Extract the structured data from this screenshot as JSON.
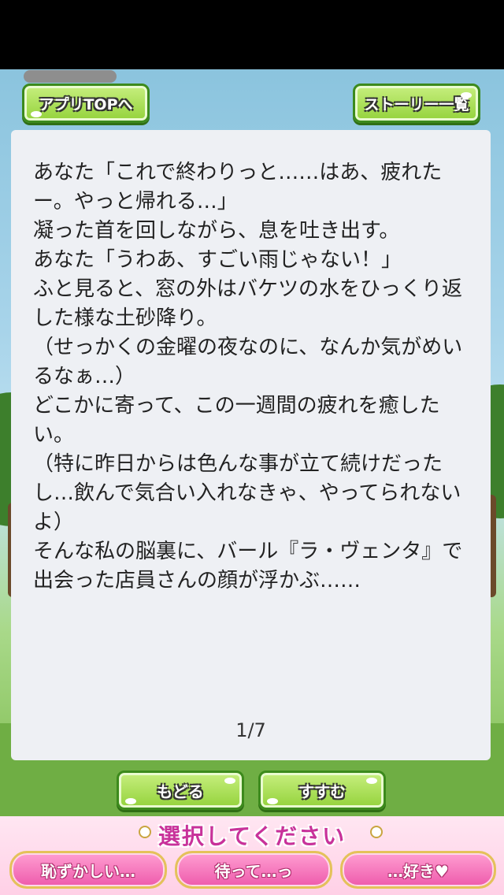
{
  "header": {
    "app_top_label": "アプリTOPへ",
    "story_list_label": "ストーリー一覧"
  },
  "story": {
    "text": "あなた「これで終わりっと……はあ、疲れたー。やっと帰れる…」\n凝った首を回しながら、息を吐き出す。\nあなた「うわあ、すごい雨じゃない！」\nふと見ると、窓の外はバケツの水をひっくり返した様な土砂降り。\n（せっかくの金曜の夜なのに、なんか気がめいるなぁ…）\nどこかに寄って、この一週間の疲れを癒したい。\n（特に昨日からは色んな事が立て続けだったし…飲んで気合い入れなきゃ、やってられないよ）\nそんな私の脳裏に、バール『ラ・ヴェンタ』で出会った店員さんの顔が浮かぶ……",
    "page_indicator": "1/7"
  },
  "nav": {
    "back_label": "もどる",
    "next_label": "すすむ"
  },
  "choices": {
    "title": "選択してください",
    "options": [
      "恥ずかしい…",
      "待って…っ",
      "…好き♥"
    ]
  },
  "colors": {
    "green_button": "#94d23b",
    "pink_button": "#ee5aab",
    "choice_title": "#c8329a",
    "panel_bg": "#eef0f4"
  }
}
